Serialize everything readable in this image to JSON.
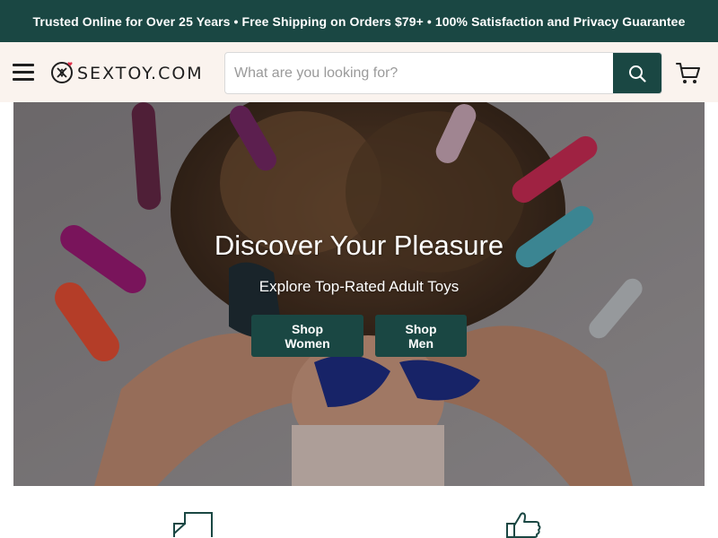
{
  "announcement": {
    "text": "Trusted Online for Over 25 Years • Free Shipping on Orders $79+ • 100% Satisfaction and Privacy Guarantee"
  },
  "header": {
    "logo_text": "SEXTOY.COM",
    "search_placeholder": "What are you looking for?"
  },
  "hero": {
    "title": "Discover Your Pleasure",
    "subtitle": "Explore Top-Rated Adult Toys",
    "buttons": [
      {
        "label": "Shop Women"
      },
      {
        "label": "Shop Men"
      }
    ]
  },
  "colors": {
    "brand_dark_green": "#1a4743",
    "header_bg": "#faf3ee",
    "accent_heart": "#e0344d"
  },
  "icons": {
    "menu": "hamburger-menu-icon",
    "logo_mark": "logo-mark-icon",
    "search": "search-icon",
    "cart": "cart-icon",
    "feature_1": "box-icon",
    "feature_2": "thumbs-up-icon"
  }
}
